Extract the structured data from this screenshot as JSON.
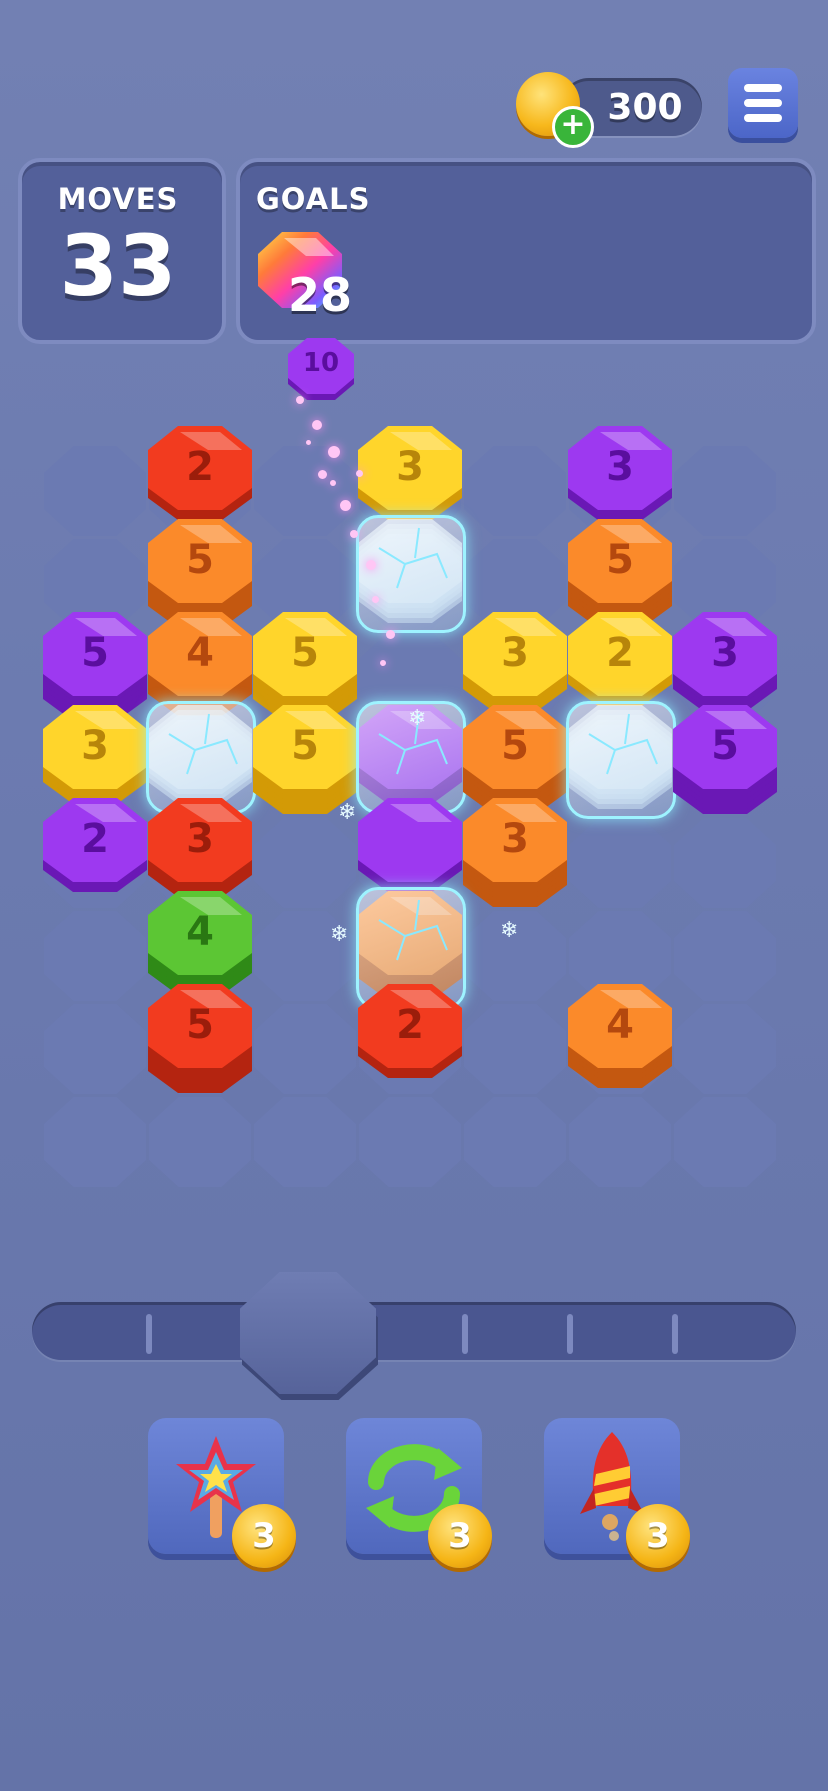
{
  "hud": {
    "coins": "300",
    "coin_plus": "+",
    "moves_label": "MOVES",
    "moves_value": "33",
    "goals_label": "GOALS",
    "goal_count": "28",
    "goal_icon": "rainbow-hexagon-icon"
  },
  "floating_tile": {
    "label": "10",
    "color": "purple"
  },
  "colors": {
    "red": "#e8331c",
    "orange": "#f3781f",
    "yellow": "#fbc618",
    "purple": "#8a2be0",
    "green": "#4fb52a",
    "slot": "#6b7ab2",
    "ice": "#9ef3ff"
  },
  "board": {
    "columns": 7,
    "rows": 8,
    "tiles": [
      {
        "row": 0,
        "col": 1,
        "color": "red",
        "label": "2",
        "stack": 2
      },
      {
        "row": 0,
        "col": 3,
        "color": "yellow",
        "label": "3",
        "stack": 2
      },
      {
        "row": 0,
        "col": 5,
        "color": "purple",
        "label": "3",
        "stack": 2
      },
      {
        "row": 1,
        "col": 1,
        "color": "orange",
        "label": "5",
        "stack": 5
      },
      {
        "row": 1,
        "col": 3,
        "color": "ice",
        "label": "",
        "stack": 4
      },
      {
        "row": 1,
        "col": 5,
        "color": "orange",
        "label": "5",
        "stack": 5
      },
      {
        "row": 2,
        "col": 0,
        "color": "purple",
        "label": "5",
        "stack": 5
      },
      {
        "row": 2,
        "col": 1,
        "color": "orange",
        "label": "4",
        "stack": 4
      },
      {
        "row": 2,
        "col": 2,
        "color": "yellow",
        "label": "5",
        "stack": 5
      },
      {
        "row": 2,
        "col": 4,
        "color": "yellow",
        "label": "3",
        "stack": 3
      },
      {
        "row": 2,
        "col": 5,
        "color": "yellow",
        "label": "2",
        "stack": 2
      },
      {
        "row": 2,
        "col": 6,
        "color": "purple",
        "label": "3",
        "stack": 3
      },
      {
        "row": 3,
        "col": 0,
        "color": "yellow",
        "label": "3",
        "stack": 3
      },
      {
        "row": 3,
        "col": 1,
        "color": "ice",
        "label": "",
        "stack": 3
      },
      {
        "row": 3,
        "col": 2,
        "color": "yellow",
        "label": "5",
        "stack": 5
      },
      {
        "row": 3,
        "col": 3,
        "color": "ice-purple",
        "label": "",
        "stack": 3
      },
      {
        "row": 3,
        "col": 4,
        "color": "orange",
        "label": "5",
        "stack": 5
      },
      {
        "row": 3,
        "col": 5,
        "color": "ice",
        "label": "",
        "stack": 4
      },
      {
        "row": 3,
        "col": 6,
        "color": "purple",
        "label": "5",
        "stack": 5
      },
      {
        "row": 4,
        "col": 0,
        "color": "purple",
        "label": "2",
        "stack": 2
      },
      {
        "row": 4,
        "col": 1,
        "color": "red",
        "label": "3",
        "stack": 3
      },
      {
        "row": 4,
        "col": 3,
        "color": "purple",
        "label": "",
        "stack": 2
      },
      {
        "row": 4,
        "col": 4,
        "color": "orange",
        "label": "3",
        "stack": 5
      },
      {
        "row": 5,
        "col": 1,
        "color": "green",
        "label": "4",
        "stack": 4
      },
      {
        "row": 5,
        "col": 3,
        "color": "ice-orange",
        "label": "",
        "stack": 5
      },
      {
        "row": 6,
        "col": 1,
        "color": "red",
        "label": "5",
        "stack": 5
      },
      {
        "row": 6,
        "col": 3,
        "color": "red",
        "label": "2",
        "stack": 2
      },
      {
        "row": 6,
        "col": 5,
        "color": "orange",
        "label": "4",
        "stack": 4
      }
    ]
  },
  "boosters": [
    {
      "name": "rainbow-star-wand",
      "icon": "rainbow-star-icon",
      "count": "3"
    },
    {
      "name": "shuffle",
      "icon": "shuffle-arrows-icon",
      "count": "3"
    },
    {
      "name": "rocket",
      "icon": "rocket-icon",
      "count": "3"
    }
  ]
}
